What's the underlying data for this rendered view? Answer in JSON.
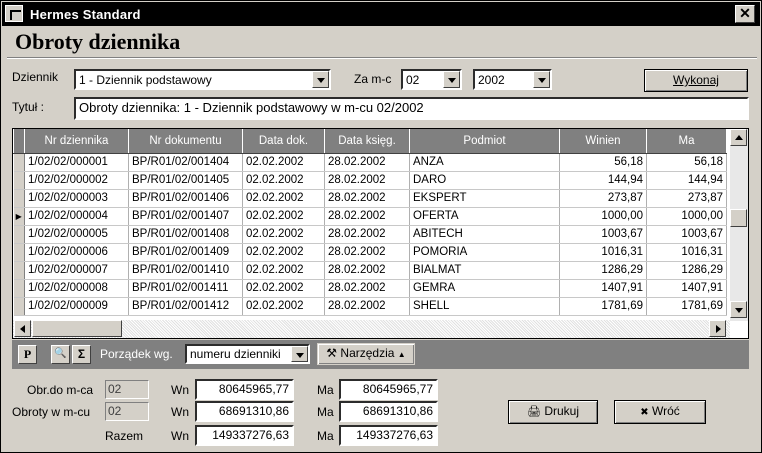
{
  "window": {
    "title": "Hermes Standard",
    "close_glyph": "✕"
  },
  "heading": "Obroty dziennika",
  "filters": {
    "dziennik_label": "Dziennik",
    "dziennik_value": "1 - Dziennik podstawowy",
    "zamc_label": "Za m-c",
    "month_value": "02",
    "year_value": "2002",
    "wykonaj_label": "Wykonaj",
    "tytul_label": "Tytuł :",
    "tytul_value": "Obroty dziennika: 1 - Dziennik podstawowy w m-cu 02/2002"
  },
  "table": {
    "columns": [
      "Nr dziennika",
      "Nr dokumentu",
      "Data dok.",
      "Data księg.",
      "Podmiot",
      "Winien",
      "Ma"
    ],
    "current_row_index": 3,
    "rows": [
      [
        "1/02/02/000001",
        "BP/R01/02/001404",
        "02.02.2002",
        "28.02.2002",
        "ANZA",
        "56,18",
        "56,18"
      ],
      [
        "1/02/02/000002",
        "BP/R01/02/001405",
        "02.02.2002",
        "28.02.2002",
        "DARO",
        "144,94",
        "144,94"
      ],
      [
        "1/02/02/000003",
        "BP/R01/02/001406",
        "02.02.2002",
        "28.02.2002",
        "EKSPERT",
        "273,87",
        "273,87"
      ],
      [
        "1/02/02/000004",
        "BP/R01/02/001407",
        "02.02.2002",
        "28.02.2002",
        "OFERTA",
        "1000,00",
        "1000,00"
      ],
      [
        "1/02/02/000005",
        "BP/R01/02/001408",
        "02.02.2002",
        "28.02.2002",
        "ABITECH",
        "1003,67",
        "1003,67"
      ],
      [
        "1/02/02/000006",
        "BP/R01/02/001409",
        "02.02.2002",
        "28.02.2002",
        "POMORIA",
        "1016,31",
        "1016,31"
      ],
      [
        "1/02/02/000007",
        "BP/R01/02/001410",
        "02.02.2002",
        "28.02.2002",
        "BIALMAT",
        "1286,29",
        "1286,29"
      ],
      [
        "1/02/02/000008",
        "BP/R01/02/001411",
        "02.02.2002",
        "28.02.2002",
        "GEMRA",
        "1407,91",
        "1407,91"
      ],
      [
        "1/02/02/000009",
        "BP/R01/02/001412",
        "02.02.2002",
        "28.02.2002",
        "SHELL",
        "1781,69",
        "1781,69"
      ]
    ]
  },
  "toolbar": {
    "p_label": "P",
    "find_glyph": "🔍",
    "sigma_label": "Σ",
    "porzadek_label": "Porządek wg.",
    "porzadek_value": "numeru dzienniki",
    "narzedzia_label": "Narzędzia",
    "narzedzia_icon": "⚒"
  },
  "summary": {
    "obr_do_label": "Obr.do m-ca",
    "obr_do_month": "02",
    "obroty_label": "Obroty w m-cu",
    "obroty_month": "02",
    "razem_label": "Razem",
    "wn_label": "Wn",
    "ma_label": "Ma",
    "obr_do_wn": "80645965,77",
    "obr_do_ma": "80645965,77",
    "obroty_wn": "68691310,86",
    "obroty_ma": "68691310,86",
    "razem_wn": "149337276,63",
    "razem_ma": "149337276,63"
  },
  "buttons": {
    "drukuj_label": "Drukuj",
    "drukuj_icon": "🖨",
    "wroc_label": "Wróć",
    "wroc_icon": "✖"
  },
  "colors": {
    "face": "#d4d0c8",
    "header": "#808080",
    "title_bg": "#000000"
  }
}
